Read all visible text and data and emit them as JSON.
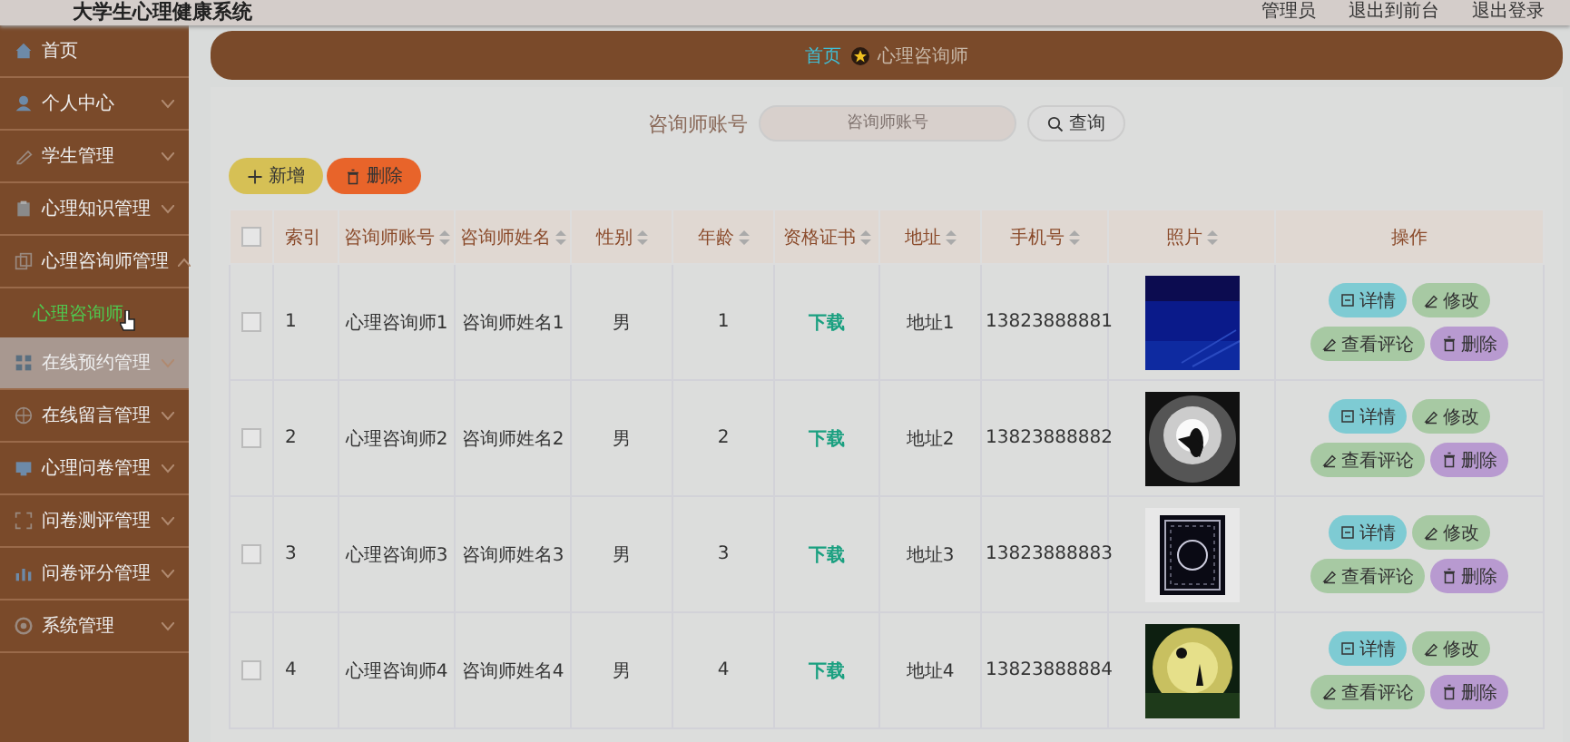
{
  "header": {
    "title": "大学生心理健康系统",
    "links": [
      "管理员",
      "退出到前台",
      "退出登录"
    ]
  },
  "sidebar": {
    "items": [
      {
        "label": "首页",
        "expandable": false,
        "hovered": false
      },
      {
        "label": "个人中心",
        "expandable": true,
        "expanded": false,
        "hovered": false
      },
      {
        "label": "学生管理",
        "expandable": true,
        "expanded": false,
        "hovered": false
      },
      {
        "label": "心理知识管理",
        "expandable": true,
        "expanded": false,
        "hovered": false
      },
      {
        "label": "心理咨询师管理",
        "expandable": true,
        "expanded": true,
        "hovered": false,
        "children": [
          {
            "label": "心理咨询师",
            "selected": true
          }
        ]
      },
      {
        "label": "在线预约管理",
        "expandable": true,
        "expanded": false,
        "hovered": true
      },
      {
        "label": "在线留言管理",
        "expandable": true,
        "expanded": false,
        "hovered": false
      },
      {
        "label": "心理问卷管理",
        "expandable": true,
        "expanded": false,
        "hovered": false
      },
      {
        "label": "问卷测评管理",
        "expandable": true,
        "expanded": false,
        "hovered": false
      },
      {
        "label": "问卷评分管理",
        "expandable": true,
        "expanded": false,
        "hovered": false
      },
      {
        "label": "系统管理",
        "expandable": true,
        "expanded": false,
        "hovered": false
      }
    ]
  },
  "breadcrumb": {
    "home": "首页",
    "current": "心理咨询师"
  },
  "search": {
    "label": "咨询师账号",
    "placeholder": "咨询师账号",
    "button": "查询"
  },
  "actions": [
    {
      "kind": "add",
      "label": "新增"
    },
    {
      "kind": "delete",
      "label": "删除"
    }
  ],
  "table": {
    "select_all_checked": false,
    "columns": [
      {
        "label": "索引",
        "sortable": false
      },
      {
        "label": "咨询师账号",
        "sortable": true
      },
      {
        "label": "咨询师姓名",
        "sortable": true
      },
      {
        "label": "性别",
        "sortable": true
      },
      {
        "label": "年龄",
        "sortable": true
      },
      {
        "label": "资格证书",
        "sortable": true
      },
      {
        "label": "地址",
        "sortable": true
      },
      {
        "label": "手机号",
        "sortable": true
      },
      {
        "label": "照片",
        "sortable": true
      },
      {
        "label": "操作",
        "sortable": false
      }
    ],
    "rows": [
      {
        "checked": false,
        "index": "1",
        "account": "心理咨询师1",
        "name": "咨询师姓名1",
        "gender": "男",
        "age": "1",
        "certificate": "下载",
        "address": "地址1",
        "phone": "13823888881",
        "actions": [
          {
            "kind": "detail",
            "label": "详情"
          },
          {
            "kind": "edit",
            "label": "修改"
          },
          {
            "kind": "comments",
            "label": "查看评论"
          },
          {
            "kind": "delete",
            "label": "删除"
          }
        ]
      },
      {
        "checked": false,
        "index": "2",
        "account": "心理咨询师2",
        "name": "咨询师姓名2",
        "gender": "男",
        "age": "2",
        "certificate": "下载",
        "address": "地址2",
        "phone": "13823888882",
        "actions": [
          {
            "kind": "detail",
            "label": "详情"
          },
          {
            "kind": "edit",
            "label": "修改"
          },
          {
            "kind": "comments",
            "label": "查看评论"
          },
          {
            "kind": "delete",
            "label": "删除"
          }
        ]
      },
      {
        "checked": false,
        "index": "3",
        "account": "心理咨询师3",
        "name": "咨询师姓名3",
        "gender": "男",
        "age": "3",
        "certificate": "下载",
        "address": "地址3",
        "phone": "13823888883",
        "actions": [
          {
            "kind": "detail",
            "label": "详情"
          },
          {
            "kind": "edit",
            "label": "修改"
          },
          {
            "kind": "comments",
            "label": "查看评论"
          },
          {
            "kind": "delete",
            "label": "删除"
          }
        ]
      },
      {
        "checked": false,
        "index": "4",
        "account": "心理咨询师4",
        "name": "咨询师姓名4",
        "gender": "男",
        "age": "4",
        "certificate": "下载",
        "address": "地址4",
        "phone": "13823888884",
        "actions": [
          {
            "kind": "detail",
            "label": "详情"
          },
          {
            "kind": "edit",
            "label": "修改"
          },
          {
            "kind": "comments",
            "label": "查看评论"
          },
          {
            "kind": "delete",
            "label": "删除"
          }
        ]
      }
    ]
  }
}
